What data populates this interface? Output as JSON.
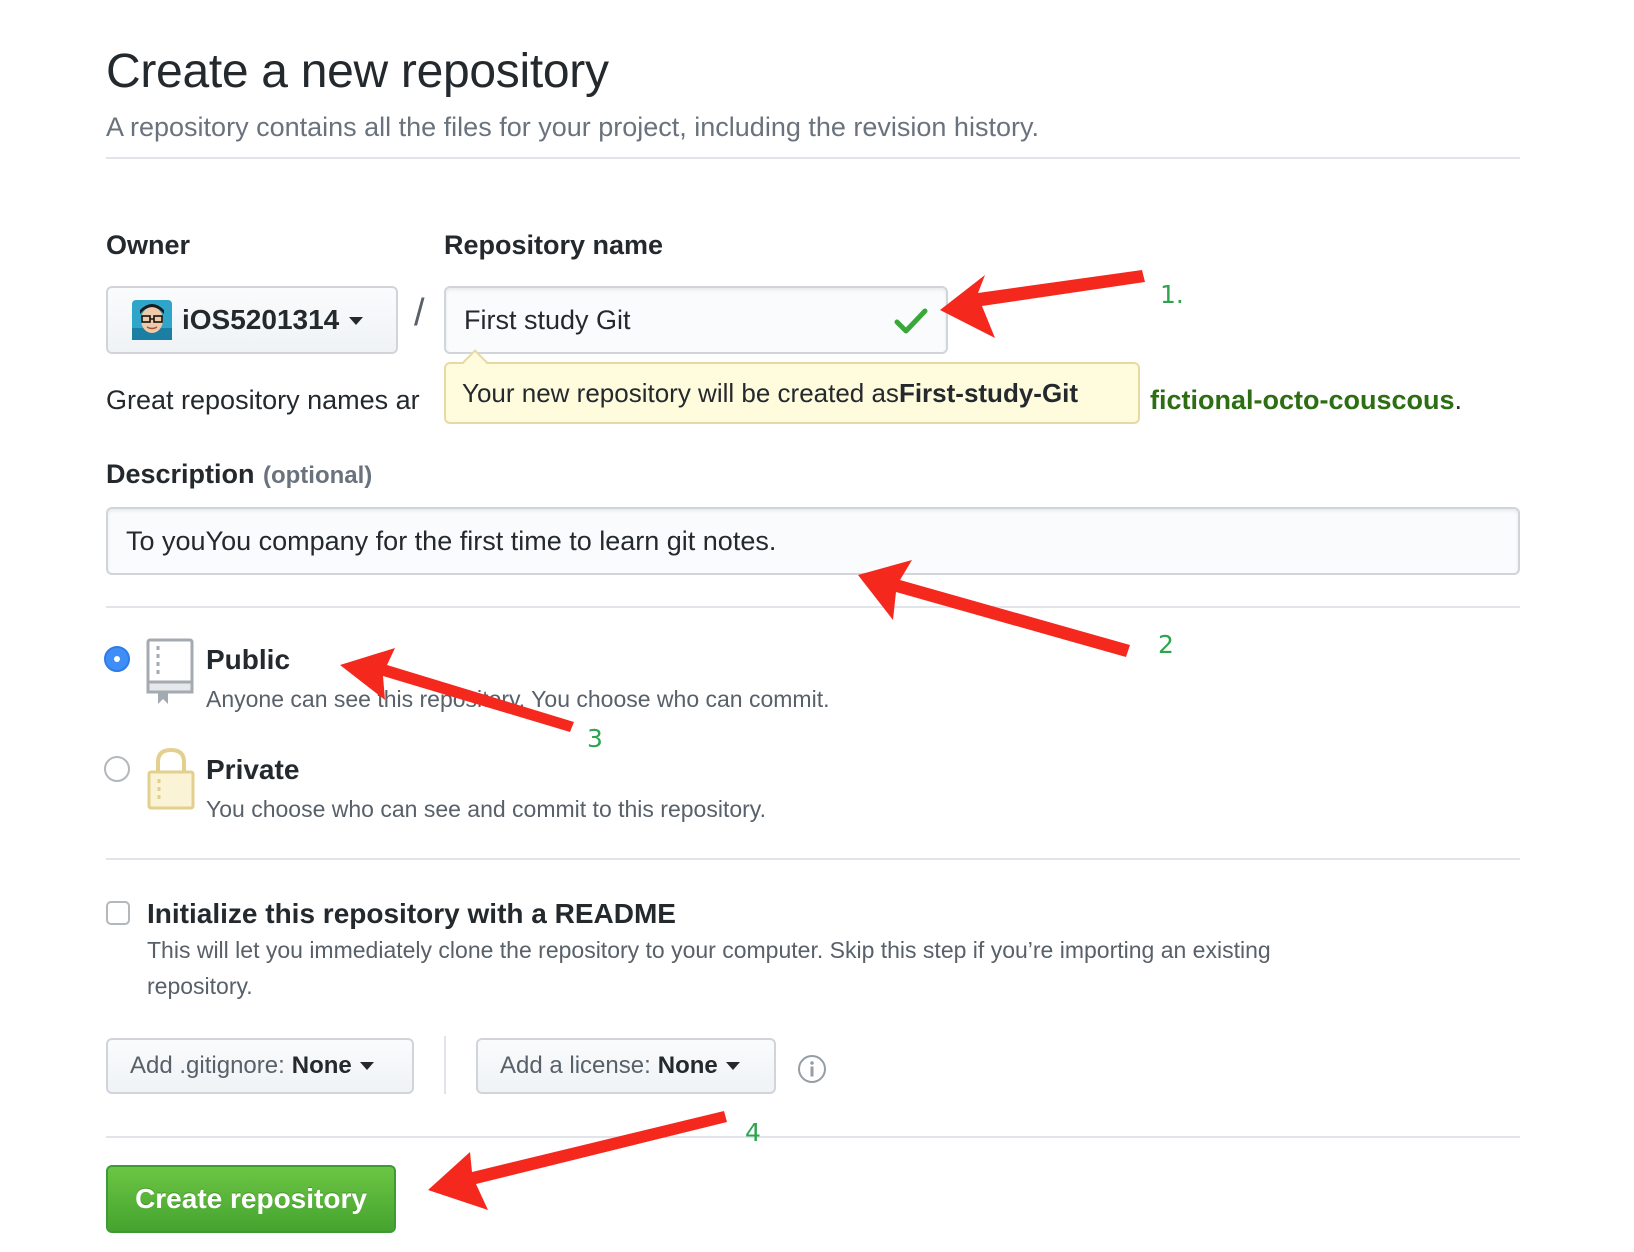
{
  "header": {
    "title": "Create a new repository",
    "subtitle": "A repository contains all the files for your project, including the revision history."
  },
  "owner": {
    "label": "Owner",
    "value": "iOS5201314"
  },
  "separator": "/",
  "repo_name": {
    "label": "Repository name",
    "value": "First study Git",
    "tooltip_prefix": "Your new repository will be created as ",
    "tooltip_name": "First-study-Git"
  },
  "hint": {
    "text_visible": "Great repository names ar",
    "suggestion": "fictional-octo-couscous",
    "suffix": "."
  },
  "description": {
    "label": "Description",
    "optional": "(optional)",
    "value": "To youYou company for the first time to learn git notes."
  },
  "visibility": {
    "public": {
      "title": "Public",
      "desc": "Anyone can see this repository. You choose who can commit.",
      "checked": true
    },
    "private": {
      "title": "Private",
      "desc": "You choose who can see and commit to this repository.",
      "checked": false
    }
  },
  "readme": {
    "title": "Initialize this repository with a README",
    "desc_line1": "This will let you immediately clone the repository to your computer. Skip this step if you’re importing an existing",
    "desc_line2": "repository.",
    "checked": false
  },
  "gitignore": {
    "label": "Add .gitignore:",
    "value": "None"
  },
  "license": {
    "label": "Add a license:",
    "value": "None"
  },
  "submit": {
    "label": "Create repository"
  },
  "annotations": {
    "n1": "1.",
    "n2": "2",
    "n3": "3",
    "n4": "4",
    "arrow_color": "#f5281e",
    "number_color": "#2ea44f"
  },
  "colors": {
    "primary_green": "#45a32f",
    "link_green": "#2c6e11",
    "radio_blue": "#3f8ef7",
    "tooltip_bg": "#fffbdd"
  },
  "icons": {
    "owner_avatar": "avatar-icon",
    "check": "check-icon",
    "public": "repo-icon",
    "private": "lock-icon",
    "info": "info-icon"
  }
}
